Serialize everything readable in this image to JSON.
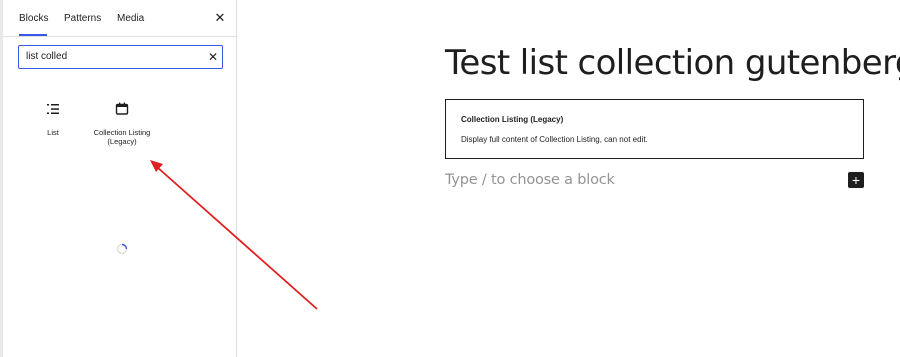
{
  "inserter": {
    "tabs": [
      {
        "label": "Blocks",
        "active": true
      },
      {
        "label": "Patterns",
        "active": false
      },
      {
        "label": "Media",
        "active": false
      }
    ],
    "close_icon": "close-icon",
    "search": {
      "value": "list colled",
      "clear_icon": "close-icon"
    },
    "results": [
      {
        "label": "List",
        "icon": "list-icon"
      },
      {
        "label": "Collection Listing (Legacy)",
        "icon": "calendar-icon"
      }
    ],
    "spinner_icon": "loading-spinner-icon"
  },
  "editor": {
    "post_title": "Test list collection gutenberg",
    "legacy_block": {
      "title": "Collection Listing (Legacy)",
      "description": "Display full content of Collection Listing, can not edit."
    },
    "appender_placeholder": "Type / to choose a block",
    "add_block_icon": "plus-icon"
  },
  "colors": {
    "accent": "#3858e9",
    "text": "#1e1e1e",
    "placeholder": "#949494",
    "annotation_arrow": "#e02020"
  }
}
